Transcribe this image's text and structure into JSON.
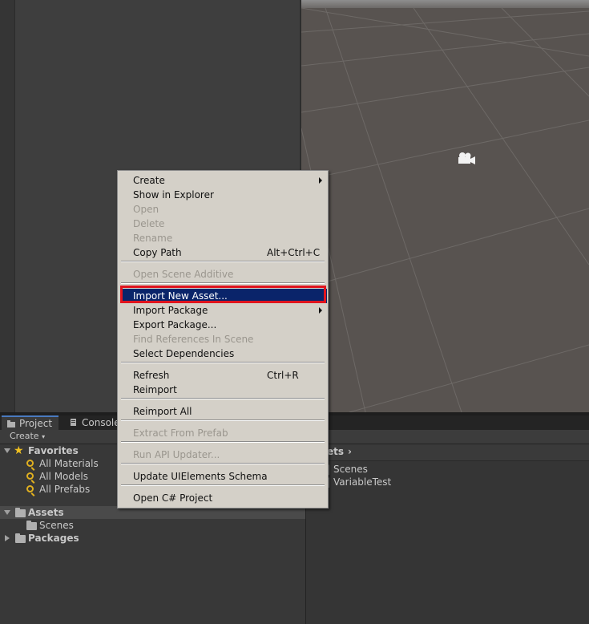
{
  "tabs": [
    {
      "label": "Project",
      "icon": "folder-icon"
    },
    {
      "label": "Console",
      "icon": "console-icon"
    }
  ],
  "toolbar": {
    "create_label": "Create"
  },
  "favorites": {
    "label": "Favorites",
    "items": [
      "All Materials",
      "All Models",
      "All Prefabs"
    ]
  },
  "assets": {
    "label": "Assets",
    "children": [
      "Scenes"
    ]
  },
  "packages": {
    "label": "Packages"
  },
  "breadcrumb": {
    "label": "ets"
  },
  "asset_list": [
    "Scenes",
    "VariableTest"
  ],
  "context_menu": {
    "items": [
      {
        "label": "Create",
        "submenu": true
      },
      {
        "label": "Show in Explorer"
      },
      {
        "label": "Open",
        "disabled": true
      },
      {
        "label": "Delete",
        "disabled": true
      },
      {
        "label": "Rename",
        "disabled": true
      },
      {
        "label": "Copy Path",
        "shortcut": "Alt+Ctrl+C"
      },
      {
        "label": "Open Scene Additive",
        "disabled": true
      },
      {
        "label": "Import New Asset...",
        "highlighted": true
      },
      {
        "label": "Import Package",
        "submenu": true
      },
      {
        "label": "Export Package..."
      },
      {
        "label": "Find References In Scene",
        "disabled": true
      },
      {
        "label": "Select Dependencies"
      },
      {
        "label": "Refresh",
        "shortcut": "Ctrl+R"
      },
      {
        "label": "Reimport"
      },
      {
        "label": "Reimport All"
      },
      {
        "label": "Extract From Prefab",
        "disabled": true
      },
      {
        "label": "Run API Updater...",
        "disabled": true
      },
      {
        "label": "Update UIElements Schema"
      },
      {
        "label": "Open C# Project"
      }
    ]
  },
  "colors": {
    "highlight": "#0a246a",
    "annotation": "#e0141e",
    "menu_bg": "#d4d0c8"
  }
}
